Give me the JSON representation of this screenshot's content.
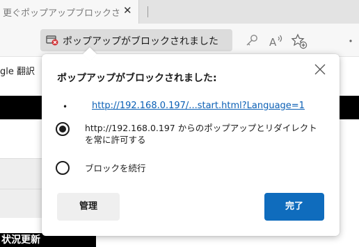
{
  "browser": {
    "tab": {
      "title": "更ぐポップアップブロックされ",
      "close_symbol": "✕"
    },
    "toolbar": {
      "blocked_indicator": {
        "label": "ポップアップがブロックされました",
        "icon": "popup-blocked-icon"
      },
      "icons": [
        "key-icon",
        "read-aloud-icon",
        "add-favorite-icon",
        "more-icon"
      ]
    }
  },
  "page": {
    "translate_text": "gle 翻訳",
    "bottom_label": "状況更新"
  },
  "popup_dialog": {
    "title": "ポップアップがブロックされました:",
    "bullet": "•",
    "blocked_link": "http://192.168.0.197/...start.html?Language=1",
    "options": [
      {
        "label": "http://192.168.0.197 からのポップアップとリダイレクトを常に許可する",
        "selected": true
      },
      {
        "label": "ブロックを続行",
        "selected": false
      }
    ],
    "manage_button": "管理",
    "done_button": "完了"
  },
  "colors": {
    "accent": "#0f6cbd",
    "link": "#0a5fb5",
    "blocked_badge": "#d13438"
  }
}
